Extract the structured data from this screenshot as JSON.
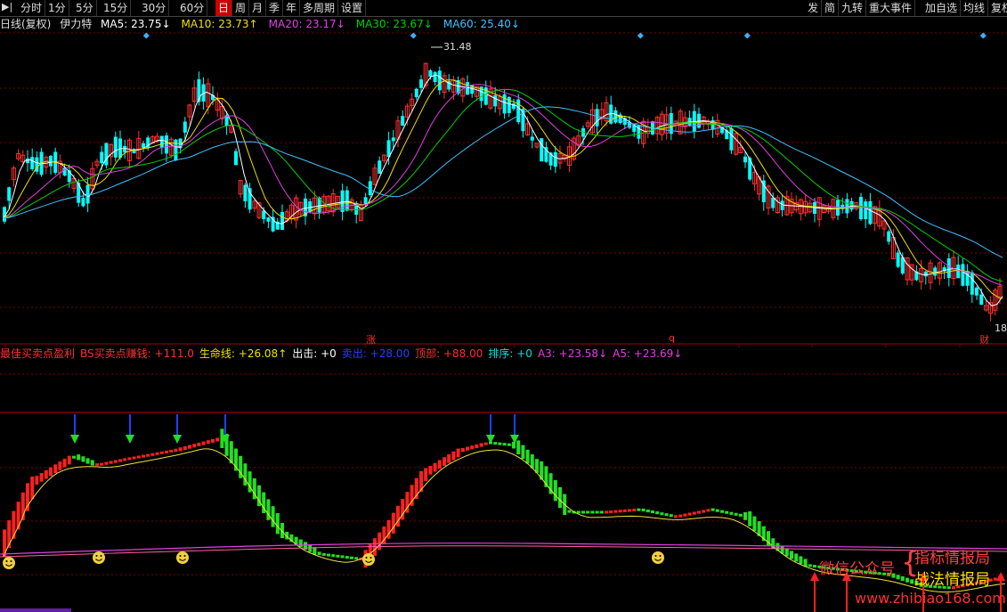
{
  "toolbar": {
    "left_buttons": [
      "分时",
      "1分",
      "5分",
      "15分",
      "30分",
      "60分",
      "日",
      "周",
      "月",
      "季",
      "年",
      "多周期",
      "设置"
    ],
    "active": "日",
    "right_buttons": [
      "发",
      "简",
      "九转",
      "重大事件",
      "加自选",
      "均线",
      "复权"
    ]
  },
  "price_panel": {
    "label": "日线(复权)",
    "stock": "伊力特",
    "ma": [
      {
        "name": "MA5",
        "value": "23.75",
        "arrow": "↓",
        "color": "#ffffff"
      },
      {
        "name": "MA10",
        "value": "23.73",
        "arrow": "↑",
        "color": "#f0e000"
      },
      {
        "name": "MA20",
        "value": "23.17",
        "arrow": "↓",
        "color": "#e040e0"
      },
      {
        "name": "MA30",
        "value": "23.67",
        "arrow": "↓",
        "color": "#00d000"
      },
      {
        "name": "MA60",
        "value": "25.40",
        "arrow": "↓",
        "color": "#40c0ff"
      }
    ],
    "high_label": "31.48",
    "low_label": "18",
    "event_marks": [
      "涨",
      "q",
      "财"
    ]
  },
  "indicator_panel": {
    "items": [
      {
        "text": "最佳买卖点盈利",
        "color": "#ff3030"
      },
      {
        "text": "BS买卖点赚钱: +111.0",
        "color": "#ff3030"
      },
      {
        "text": "生命线: +26.08↑",
        "color": "#f0e000"
      },
      {
        "text": "出击: +0",
        "color": "#ffffff"
      },
      {
        "text": "卖出: +28.00",
        "color": "#2040ff"
      },
      {
        "text": "顶部: +88.00",
        "color": "#ff3030"
      },
      {
        "text": "排序: +0",
        "color": "#00e0e0"
      },
      {
        "text": "A3: +23.58↓",
        "color": "#e040e0"
      },
      {
        "text": "A5: +23.69↓",
        "color": "#e040e0"
      }
    ],
    "sell_marks": 6,
    "buy_marks": 4
  },
  "watermark": {
    "wechat": "微信公众号",
    "line1": "指标情报局",
    "line2": "战法情报局",
    "site": "www.zhibiao168.com"
  },
  "colors": {
    "up": "#ff3030",
    "down": "#00ffff",
    "grid": "#7a0000"
  }
}
